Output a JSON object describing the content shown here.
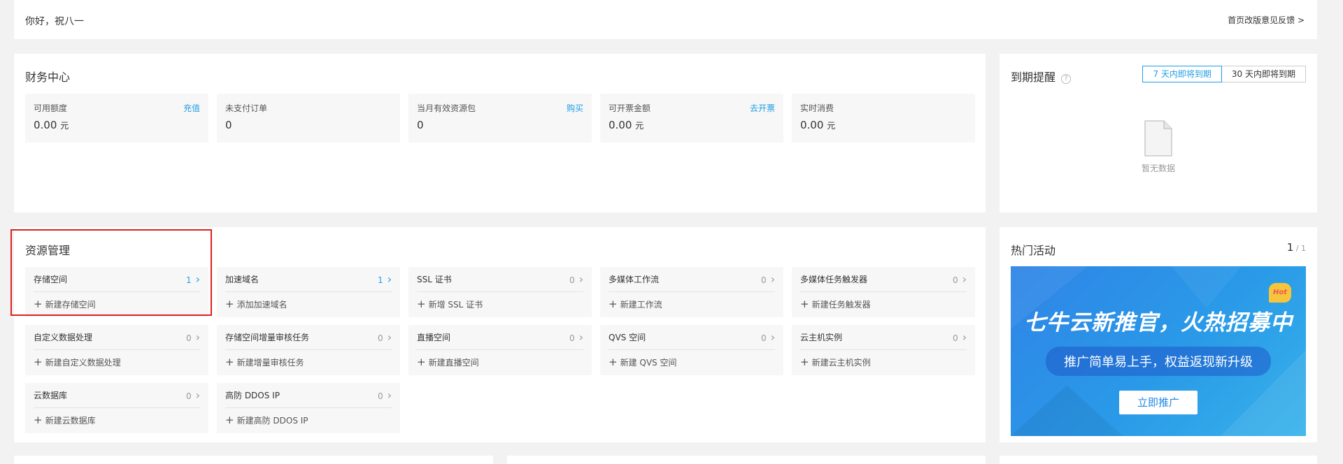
{
  "greeting": {
    "hello": "你好，祝八一",
    "feedback": "首页改版意见反馈 >"
  },
  "finance": {
    "title": "财务中心",
    "items": [
      {
        "label": "可用额度",
        "action": "充值",
        "value": "0.00",
        "unit": "元"
      },
      {
        "label": "未支付订单",
        "action": "",
        "value": "0",
        "unit": ""
      },
      {
        "label": "当月有效资源包",
        "action": "购买",
        "value": "0",
        "unit": ""
      },
      {
        "label": "可开票金额",
        "action": "去开票",
        "value": "0.00",
        "unit": "元"
      },
      {
        "label": "实时消费",
        "action": "",
        "value": "0.00",
        "unit": "元"
      }
    ]
  },
  "expiry": {
    "title": "到期提醒",
    "help_icon": "?",
    "tabs": [
      "7 天内即将到期",
      "30 天内即将到期"
    ],
    "empty_text": "暂无数据"
  },
  "resources": {
    "title": "资源管理",
    "items": [
      {
        "name": "存储空间",
        "count": "1",
        "add": "新建存储空间"
      },
      {
        "name": "加速域名",
        "count": "1",
        "add": "添加加速域名"
      },
      {
        "name": "SSL 证书",
        "count": "0",
        "add": "新增 SSL 证书"
      },
      {
        "name": "多媒体工作流",
        "count": "0",
        "add": "新建工作流"
      },
      {
        "name": "多媒体任务触发器",
        "count": "0",
        "add": "新建任务触发器"
      },
      {
        "name": "自定义数据处理",
        "count": "0",
        "add": "新建自定义数据处理"
      },
      {
        "name": "存储空间增量审核任务",
        "count": "0",
        "add": "新建增量审核任务"
      },
      {
        "name": "直播空间",
        "count": "0",
        "add": "新建直播空间"
      },
      {
        "name": "QVS 空间",
        "count": "0",
        "add": "新建 QVS 空间"
      },
      {
        "name": "云主机实例",
        "count": "0",
        "add": "新建云主机实例"
      },
      {
        "name": "云数据库",
        "count": "0",
        "add": "新建云数据库"
      },
      {
        "name": "高防 DDOS IP",
        "count": "0",
        "add": "新建高防 DDOS IP"
      }
    ]
  },
  "hot": {
    "title": "热门活动",
    "page": "1",
    "total": " / 1",
    "banner": {
      "headline": "七牛云新推官，火热招募中",
      "sub": "推广简单易上手，权益返现新升级",
      "cta": "立即推广",
      "badge": "Hot"
    }
  },
  "colors": {
    "accent": "#1e9ee6",
    "highlight": "#e0201c",
    "banner": "#2a9ae8"
  }
}
